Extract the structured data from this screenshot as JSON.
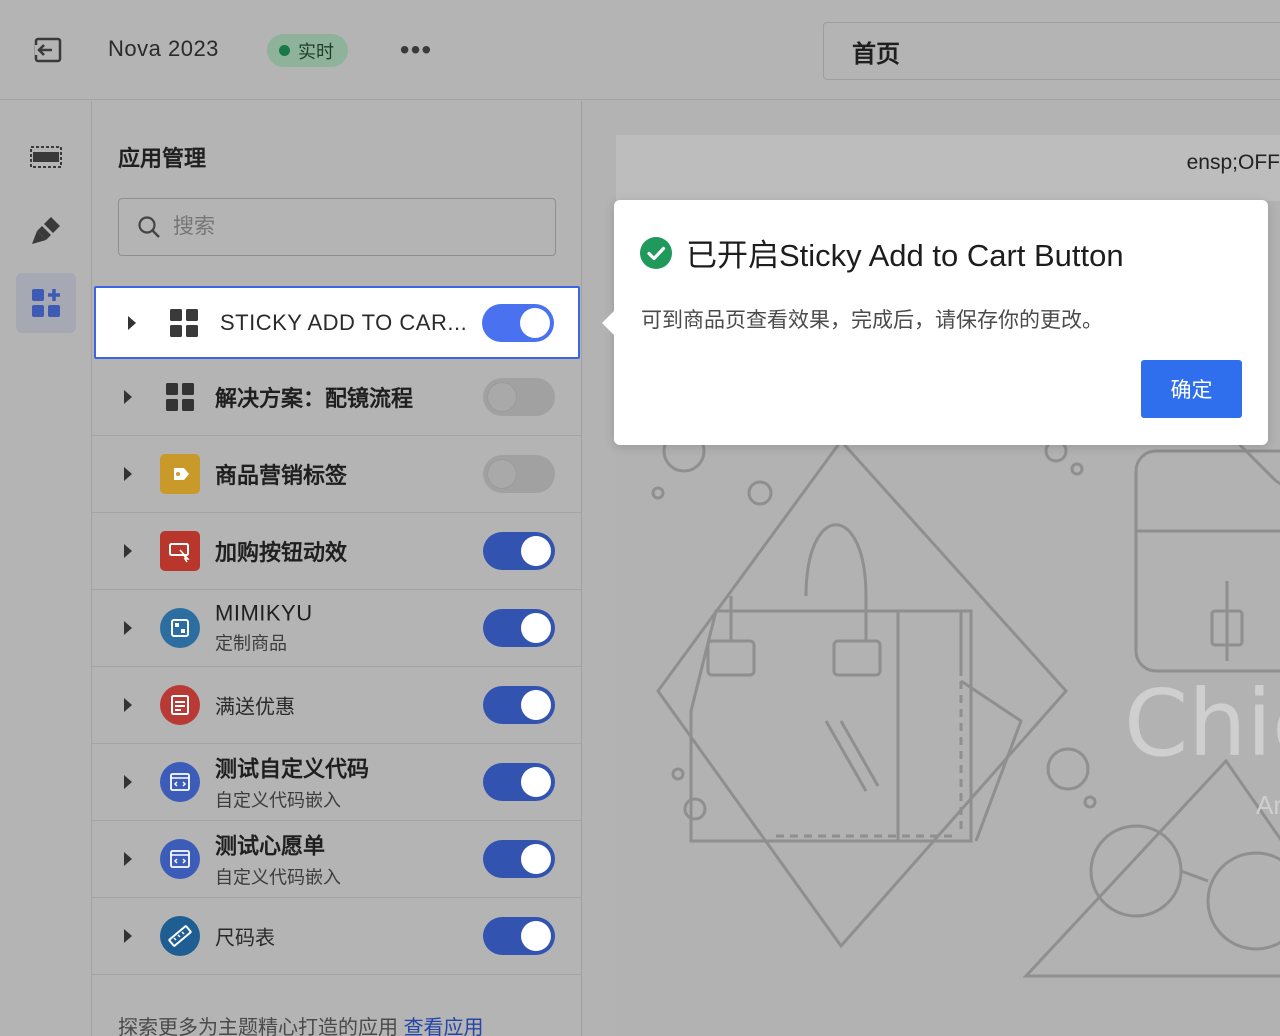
{
  "topbar": {
    "store_name": "Nova 2023",
    "live_badge": "实时",
    "more_label": "•••",
    "page_select": "首页"
  },
  "panel": {
    "title": "应用管理",
    "search_placeholder": "搜索",
    "apps": [
      {
        "name": "STICKY ADD TO CAR...",
        "subtitle": "",
        "enabled": true,
        "icon": "grid-icon"
      },
      {
        "name": "解决方案：配镜流程",
        "subtitle": "",
        "enabled": false,
        "icon": "grid-icon"
      },
      {
        "name": "商品营销标签",
        "subtitle": "",
        "enabled": false,
        "icon": "tag-icon"
      },
      {
        "name": "加购按钮动效",
        "subtitle": "",
        "enabled": true,
        "icon": "cursor-click-icon"
      },
      {
        "name": "MIMIKYU",
        "subtitle": "定制商品",
        "enabled": true,
        "icon": "customize-icon"
      },
      {
        "name": "满送优惠",
        "subtitle": "",
        "enabled": true,
        "icon": "receipt-icon"
      },
      {
        "name": "测试自定义代码",
        "subtitle": "自定义代码嵌入",
        "enabled": true,
        "icon": "code-window-icon"
      },
      {
        "name": "测试心愿单",
        "subtitle": "自定义代码嵌入",
        "enabled": true,
        "icon": "code-window-icon"
      },
      {
        "name": "尺码表",
        "subtitle": "",
        "enabled": true,
        "icon": "ruler-icon"
      }
    ],
    "explore_text": "探索更多为主题精心打造的应用",
    "explore_link": "查看应用"
  },
  "preview": {
    "bar_text": "ensp;OFF",
    "hero_text": "Chic",
    "hero_sub": "Ar"
  },
  "popover": {
    "title": "已开启Sticky Add to Cart Button",
    "body": "可到商品页查看效果，完成后，请保存你的更改。",
    "confirm_label": "确定"
  },
  "colors": {
    "accent": "#2f6fee",
    "toggle_on": "#3353b0",
    "live_dot": "#1a7a45"
  }
}
